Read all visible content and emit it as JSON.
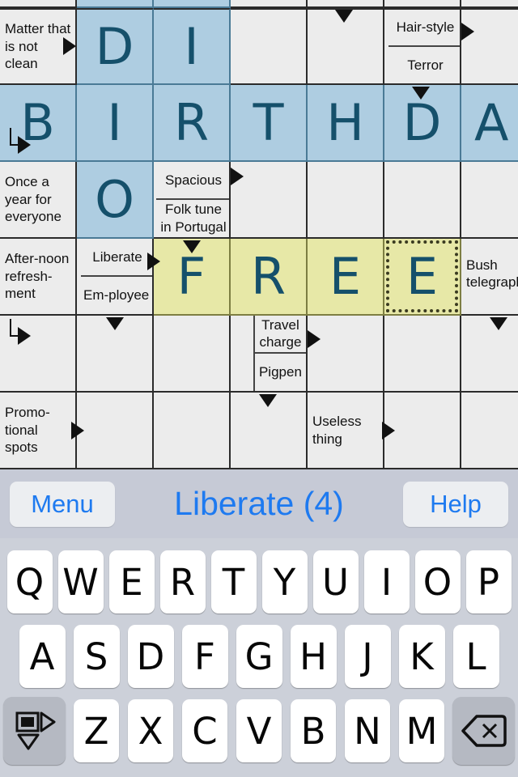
{
  "app": {
    "type": "arrow-word crossword puzzle"
  },
  "toolbar": {
    "menu_label": "Menu",
    "title": "Liberate (4)",
    "help_label": "Help",
    "accent_color": "#1e7af0",
    "background_color": "#c6cad6"
  },
  "grid": {
    "columns": 7,
    "rows": 6,
    "cell_size": 95,
    "colors": {
      "empty": "#ececec",
      "across_highlight_blue": "#aecde1",
      "active_word_yellow": "#e7e8a7",
      "letter": "#15506b",
      "gridline": "#2b2b2b",
      "selection_border": "#3a3a20"
    },
    "letters": {
      "r1c2": "D",
      "r1c3": "I",
      "r2c1": "B",
      "r2c2": "I",
      "r2c3": "R",
      "r2c4": "T",
      "r2c5": "H",
      "r2c6": "D",
      "r2c7": "A",
      "r3c2": "O",
      "r4c3": "F",
      "r4c4": "R",
      "r4c5": "E",
      "r4c6": "E"
    },
    "clues": {
      "matter_not_clean": "Matter that is not clean",
      "hair_style": "Hair-style",
      "terror": "Terror",
      "once_a_year": "Once a year for everyone",
      "spacious": "Spacious",
      "folk_tune": "Folk tune in Portugal",
      "afternoon_refreshment": "After-noon refresh-ment",
      "liberate": "Liberate",
      "employee": "Em-ployee",
      "bush_telegraph": "Bush telegraph",
      "travel_charge": "Travel charge",
      "pigpen": "Pigpen",
      "promotional_spots": "Promo-tional spots",
      "useless_thing": "Useless thing"
    },
    "selected_cell": "r4c6"
  },
  "keyboard": {
    "background_color": "#ccd0d9",
    "row1": [
      "Q",
      "W",
      "E",
      "R",
      "T",
      "Y",
      "U",
      "I",
      "O",
      "P"
    ],
    "row2": [
      "A",
      "S",
      "D",
      "F",
      "G",
      "H",
      "J",
      "K",
      "L"
    ],
    "row3": [
      "Z",
      "X",
      "C",
      "V",
      "B",
      "N",
      "M"
    ],
    "direction_key_name": "direction-toggle",
    "backspace_key_name": "backspace"
  }
}
